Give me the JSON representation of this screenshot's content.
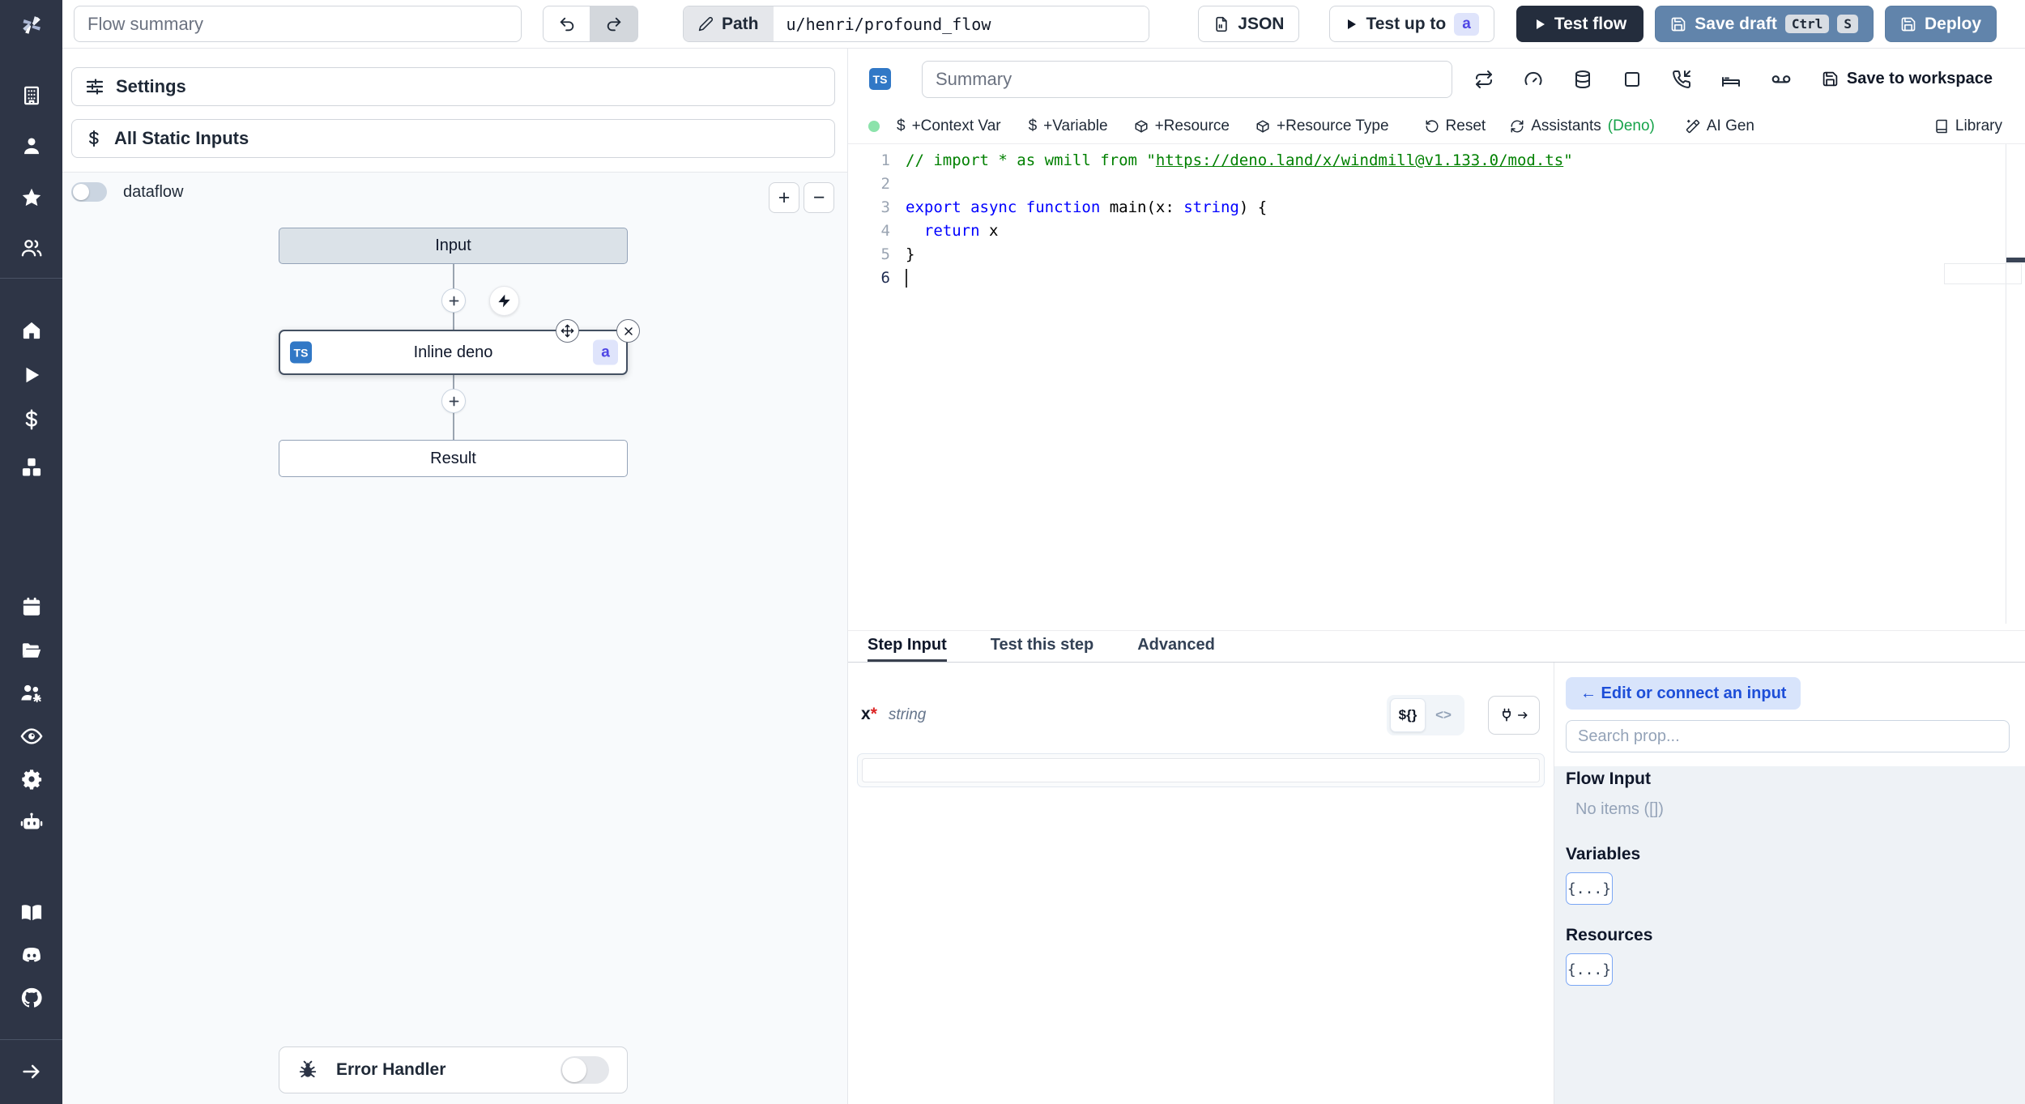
{
  "topbar": {
    "flow_summary_placeholder": "Flow summary",
    "path_label": "Path",
    "path_value": "u/henri/profound_flow",
    "json_label": "JSON",
    "test_up_to_label": "Test up to",
    "test_up_to_badge": "a",
    "test_flow_label": "Test flow",
    "save_draft_label": "Save draft",
    "kbd_ctrl": "Ctrl",
    "kbd_s": "S",
    "deploy_label": "Deploy"
  },
  "sidebar": {
    "icons": [
      "windmill-logo",
      "building",
      "user",
      "star",
      "users",
      "home",
      "play",
      "dollar-sign",
      "boxes",
      "calendar",
      "folder-open",
      "users-gear",
      "eye",
      "gear",
      "robot",
      "book-open",
      "discord",
      "github",
      "arrow-right"
    ]
  },
  "left_panel": {
    "settings_label": "Settings",
    "static_inputs_label": "All Static Inputs",
    "dataflow_label": "dataflow",
    "zoom_in_label": "+",
    "zoom_out_label": "−",
    "nodes": {
      "input_label": "Input",
      "step_label": "Inline deno",
      "step_lang_badge": "TS",
      "step_id_badge": "a",
      "result_label": "Result"
    },
    "error_handler_label": "Error Handler"
  },
  "editor": {
    "lang_badge": "TS",
    "summary_placeholder": "Summary",
    "save_to_workspace_label": "Save to workspace",
    "toolbar": {
      "context_var": "+Context Var",
      "variable": "+Variable",
      "resource": "+Resource",
      "resource_type": "+Resource Type",
      "reset": "Reset",
      "assistants": "Assistants",
      "assistants_lang": "(Deno)",
      "ai_gen": "AI Gen",
      "library": "Library"
    },
    "code": {
      "lines": [
        {
          "num": "1",
          "tokens": [
            {
              "t": "// import * as wmill from \"",
              "c": "cmt"
            },
            {
              "t": "https://deno.land/x/windmill@v1.133.0/mod.ts",
              "c": "cmt-link"
            },
            {
              "t": "\"",
              "c": "cmt"
            }
          ]
        },
        {
          "num": "2",
          "tokens": []
        },
        {
          "num": "3",
          "tokens": [
            {
              "t": "export",
              "c": "kw"
            },
            {
              "t": " ",
              "c": "pl"
            },
            {
              "t": "async",
              "c": "kw"
            },
            {
              "t": " ",
              "c": "pl"
            },
            {
              "t": "function",
              "c": "kw"
            },
            {
              "t": " main(x: ",
              "c": "pl"
            },
            {
              "t": "string",
              "c": "kw"
            },
            {
              "t": ") {",
              "c": "pl"
            }
          ]
        },
        {
          "num": "4",
          "tokens": [
            {
              "t": "  ",
              "c": "pl"
            },
            {
              "t": "return",
              "c": "kw"
            },
            {
              "t": " x",
              "c": "pl"
            }
          ]
        },
        {
          "num": "5",
          "tokens": [
            {
              "t": "}",
              "c": "pl"
            }
          ]
        },
        {
          "num": "6",
          "tokens": [],
          "cursor": true,
          "active": true
        }
      ]
    }
  },
  "bottom": {
    "tabs": [
      {
        "label": "Step Input",
        "active": true
      },
      {
        "label": "Test this step",
        "active": false
      },
      {
        "label": "Advanced",
        "active": false
      }
    ],
    "arg": {
      "name": "x",
      "required_mark": "*",
      "type": "string",
      "expr_toggle_label": "${}",
      "code_toggle_label": "<>"
    },
    "connect": {
      "edit_button_label": "← Edit or connect an input",
      "search_placeholder": "Search prop...",
      "flow_input_heading": "Flow Input",
      "no_items_label": "No items ([])",
      "variables_heading": "Variables",
      "resources_heading": "Resources",
      "braces_label": "{...}"
    }
  },
  "colors": {
    "sidebar_bg": "#2e3546",
    "primary_steel_blue": "#6184ab",
    "dark_navy_button": "#242d3d",
    "badge_indigo": "#4f46e5",
    "badge_indigo_bg": "#dfe4fb",
    "ts_blue": "#3178c6",
    "status_dot_green": "#8ce3ab",
    "deno_green": "#16a34a",
    "code_keyword": "#0000ff",
    "code_comment": "#008000"
  }
}
